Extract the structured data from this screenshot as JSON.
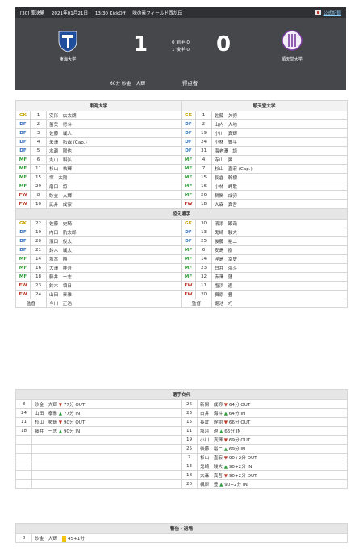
{
  "header": {
    "round": "[30] 準決勝",
    "date": "2021年01月21日",
    "kickoff": "13:30 KickOff",
    "venue": "味の素フィールド西が丘",
    "official_link": "公式記録"
  },
  "home": {
    "name": "東海大学",
    "score": "1",
    "color": "#1f4f9c"
  },
  "away": {
    "name": "順天堂大学",
    "score": "0",
    "color": "#7a3aa0"
  },
  "halves": [
    {
      "home": "0",
      "label": "前半",
      "away": "0"
    },
    {
      "home": "1",
      "label": "後半",
      "away": "0"
    }
  ],
  "goals": [
    {
      "time": "60分",
      "player": "砂金　大輝"
    }
  ],
  "scorers_label": "得点者",
  "sections": {
    "starters_home": "東海大学",
    "starters_away": "順天堂大学",
    "bench": "控え選手",
    "subs": "選手交代",
    "cards": "警告・退場"
  },
  "starters": [
    {
      "hp": "GK",
      "hn": "1",
      "hname": "安形　広太朗",
      "ap": "GK",
      "an": "1",
      "aname": "佐藤　久弥"
    },
    {
      "hp": "DF",
      "hn": "2",
      "hname": "笛矢　行斗",
      "ap": "DF",
      "an": "2",
      "aname": "山内　大地"
    },
    {
      "hp": "DF",
      "hn": "3",
      "hname": "佐藤　颯人",
      "ap": "DF",
      "an": "19",
      "aname": "小川　真輝"
    },
    {
      "hp": "DF",
      "hn": "4",
      "hname": "米澤　拓哉 (Cap.)",
      "ap": "DF",
      "an": "24",
      "aname": "小林　響平"
    },
    {
      "hp": "DF",
      "hn": "5",
      "hname": "水越　陽也",
      "ap": "DF",
      "an": "31",
      "aname": "海老澤　諒"
    },
    {
      "hp": "MF",
      "hn": "6",
      "hname": "丸山　科弘",
      "ap": "MF",
      "an": "4",
      "aname": "寺山　翼"
    },
    {
      "hp": "MF",
      "hn": "11",
      "hname": "杉山　祐輝",
      "ap": "MF",
      "an": "7",
      "aname": "杉山　直宏 (Cap.)"
    },
    {
      "hp": "MF",
      "hn": "15",
      "hname": "塚　太陽",
      "ap": "MF",
      "an": "15",
      "aname": "長倉　幹樹"
    },
    {
      "hp": "MF",
      "hn": "29",
      "hname": "扇田　悠",
      "ap": "MF",
      "an": "16",
      "aname": "小林　岬敬"
    },
    {
      "hp": "FW",
      "hn": "8",
      "hname": "砂金　大輝",
      "ap": "MF",
      "an": "26",
      "aname": "新関　成弥"
    },
    {
      "hp": "FW",
      "hn": "10",
      "hname": "武井　成豪",
      "ap": "FW",
      "an": "18",
      "aname": "大森　真吾"
    }
  ],
  "bench": [
    {
      "hp": "GK",
      "hn": "22",
      "hname": "佐藤　史騎",
      "ap": "GK",
      "an": "30",
      "aname": "濱添　顕哉"
    },
    {
      "hp": "DF",
      "hn": "19",
      "hname": "内田　航太郎",
      "ap": "DF",
      "an": "13",
      "aname": "鬼崎　駿大"
    },
    {
      "hp": "DF",
      "hn": "20",
      "hname": "濱口　俊太",
      "ap": "DF",
      "an": "25",
      "aname": "後藤　裕二"
    },
    {
      "hp": "DF",
      "hn": "21",
      "hname": "鈴木　颯太",
      "ap": "MF",
      "an": "6",
      "aname": "安島　樹"
    },
    {
      "hp": "MF",
      "hn": "14",
      "hname": "坂本　翔",
      "ap": "MF",
      "an": "14",
      "aname": "淫島　幸史"
    },
    {
      "hp": "MF",
      "hn": "16",
      "hname": "大澤　祥吾",
      "ap": "MF",
      "an": "23",
      "aname": "白井　海斗"
    },
    {
      "hp": "MF",
      "hn": "18",
      "hname": "藤井　一志",
      "ap": "MF",
      "an": "32",
      "aname": "赤澤　蓮"
    },
    {
      "hp": "FW",
      "hn": "23",
      "hname": "鈴木　領日",
      "ap": "FW",
      "an": "11",
      "aname": "塩浜　遼"
    },
    {
      "hp": "FW",
      "hn": "24",
      "hname": "山田　泰雅",
      "ap": "FW",
      "an": "20",
      "aname": "楓原　豊"
    }
  ],
  "managers": {
    "label": "監督",
    "home": "今川　正浩",
    "away": "堀池　巧"
  },
  "subs_home": [
    {
      "num": "8",
      "name": "砂金　大輝",
      "dir": "down",
      "time": "77分 OUT"
    },
    {
      "num": "24",
      "name": "山田　泰雅",
      "dir": "up",
      "time": "77分 IN"
    },
    {
      "num": "11",
      "name": "杉山　祐輝",
      "dir": "down",
      "time": "90分 OUT"
    },
    {
      "num": "18",
      "name": "藤井　一志",
      "dir": "up",
      "time": "90分 IN"
    }
  ],
  "subs_away": [
    {
      "num": "26",
      "name": "新関　成弥",
      "dir": "down",
      "time": "64分 OUT"
    },
    {
      "num": "23",
      "name": "白井　海斗",
      "dir": "up",
      "time": "64分 IN"
    },
    {
      "num": "15",
      "name": "長倉　幹樹",
      "dir": "down",
      "time": "66分 OUT"
    },
    {
      "num": "11",
      "name": "塩浜　遼",
      "dir": "up",
      "time": "66分 IN"
    },
    {
      "num": "19",
      "name": "小川　真輝",
      "dir": "down",
      "time": "69分 OUT"
    },
    {
      "num": "25",
      "name": "後藤　裕二",
      "dir": "up",
      "time": "69分 IN"
    },
    {
      "num": "7",
      "name": "杉山　直宏",
      "dir": "down",
      "time": "90+2分 OUT"
    },
    {
      "num": "13",
      "name": "鬼崎　駿大",
      "dir": "up",
      "time": "90+2分 IN"
    },
    {
      "num": "18",
      "name": "大森　真吾",
      "dir": "down",
      "time": "90+2分 OUT"
    },
    {
      "num": "20",
      "name": "楓原　豊",
      "dir": "up",
      "time": "90+2分 IN"
    }
  ],
  "cards": [
    {
      "num": "8",
      "name": "砂金　大輝",
      "card": "yellow",
      "time": "45+1分"
    }
  ]
}
